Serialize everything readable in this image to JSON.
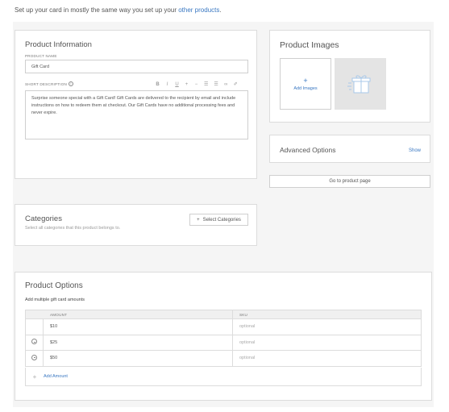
{
  "intro": {
    "text": "Set up your card in mostly the same way you set up your",
    "link": "other products",
    "suffix": "."
  },
  "product_info": {
    "title": "Product Information",
    "name_label": "PRODUCT NAME",
    "name_value": "Gift Card",
    "desc_label": "SHORT DESCRIPTION",
    "info_icon": "i",
    "toolbar": [
      "B",
      "I",
      "U",
      "+",
      "−",
      "☰",
      "☰",
      "∞",
      "✐"
    ],
    "description": "Surprise someone special with a Gift Card! Gift Cards are delivered to the recipient by email and include instructions on how to redeem them at checkout. Our Gift Cards have no additional processing fees and never expire."
  },
  "product_images": {
    "title": "Product Images",
    "add_plus": "+",
    "add_label": "Add Images"
  },
  "advanced": {
    "title": "Advanced Options",
    "show": "Show"
  },
  "go_to_page": "Go to product page",
  "categories": {
    "title": "Categories",
    "hint": "Select all categories that this product belongs to.",
    "button_plus": "+",
    "button_label": "Select Categories"
  },
  "options": {
    "title": "Product Options",
    "subtitle": "Add multiple gift card amounts",
    "col_amount": "AMOUNT",
    "col_sku": "SKU",
    "rows": [
      {
        "amount": "$10",
        "sku": "optional"
      },
      {
        "amount": "$25",
        "sku": "optional"
      },
      {
        "amount": "$50",
        "sku": "optional"
      }
    ],
    "add_plus": "+",
    "add_label": "Add Amount"
  },
  "colors": {
    "link": "#3a78c2",
    "panel_bg": "#f5f5f5",
    "border": "#dcdcdc"
  }
}
